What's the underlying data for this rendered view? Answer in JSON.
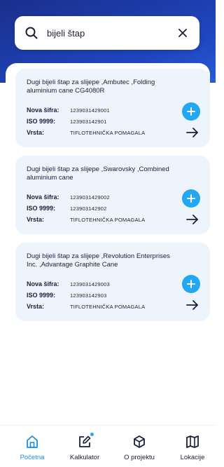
{
  "search": {
    "value": "bijeli štap",
    "search_icon": "search-icon",
    "clear_icon": "close-icon"
  },
  "labels": {
    "new_code": "Nova šifra:",
    "iso": "ISO 9999:",
    "type": "Vrsta:"
  },
  "results": [
    {
      "title": "Dugi bijeli štap za slijepe ,Ambutec ,Folding aluminium cane CG4080R",
      "new_code": "1239031429001",
      "iso": "123903142901",
      "type": "TIFLOTEHNIČKA POMAGALA"
    },
    {
      "title": "Dugi bijeli štap za slijepe ,Swarovsky ,Combined aluminium cane",
      "new_code": "1239031429002",
      "iso": "123903142902",
      "type": "TIFLOTEHNIČKA POMAGALA"
    },
    {
      "title": "Dugi bijeli štap za slijepe ,Revolution Enterprises Inc. ,Advantage Graphite Cane",
      "new_code": "1239031429003",
      "iso": "123903142903",
      "type": "TIFLOTEHNIČKA POMAGALA"
    }
  ],
  "tabs": [
    {
      "label": "Početna",
      "icon": "home-icon",
      "active": true
    },
    {
      "label": "Kalkulator",
      "icon": "edit-icon",
      "active": false
    },
    {
      "label": "O projektu",
      "icon": "cube-icon",
      "active": false
    },
    {
      "label": "Lokacije",
      "icon": "map-icon",
      "active": false
    }
  ],
  "colors": {
    "header": "#1f46c0",
    "accent": "#23a7f2",
    "card_bg": "#eef4fb",
    "text": "#1b1f3a",
    "active_tab": "#1a8fe0"
  }
}
